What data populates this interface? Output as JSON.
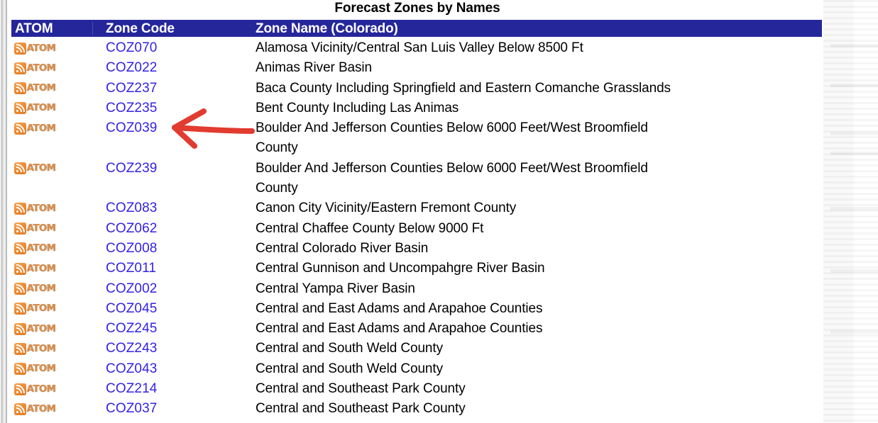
{
  "page": {
    "title": "Forecast Zones by Names"
  },
  "table": {
    "headers": {
      "atom": "ATOM",
      "zone_code": "Zone Code",
      "zone_name": "Zone Name   (Colorado)"
    },
    "atom_label": "ATOM",
    "atom_icon": "rss-feed-icon",
    "rows": [
      {
        "atom": "ATOM",
        "code": "COZ070",
        "name": "Alamosa Vicinity/Central San Luis Valley Below 8500 Ft"
      },
      {
        "atom": "ATOM",
        "code": "COZ022",
        "name": "Animas River Basin"
      },
      {
        "atom": "ATOM",
        "code": "COZ237",
        "name": "Baca County Including Springfield and Eastern Comanche Grasslands"
      },
      {
        "atom": "ATOM",
        "code": "COZ235",
        "name": "Bent County Including Las Animas"
      },
      {
        "atom": "ATOM",
        "code": "COZ039",
        "name": "Boulder And Jefferson Counties Below 6000 Feet/West Broomfield\nCounty"
      },
      {
        "atom": "ATOM",
        "code": "COZ239",
        "name": "Boulder And Jefferson Counties Below 6000 Feet/West Broomfield\nCounty"
      },
      {
        "atom": "ATOM",
        "code": "COZ083",
        "name": "Canon City Vicinity/Eastern Fremont County"
      },
      {
        "atom": "ATOM",
        "code": "COZ062",
        "name": "Central Chaffee County Below 9000 Ft"
      },
      {
        "atom": "ATOM",
        "code": "COZ008",
        "name": "Central Colorado River Basin"
      },
      {
        "atom": "ATOM",
        "code": "COZ011",
        "name": "Central Gunnison and Uncompahgre River Basin"
      },
      {
        "atom": "ATOM",
        "code": "COZ002",
        "name": "Central Yampa River Basin"
      },
      {
        "atom": "ATOM",
        "code": "COZ045",
        "name": "Central and East Adams and Arapahoe Counties"
      },
      {
        "atom": "ATOM",
        "code": "COZ245",
        "name": "Central and East Adams and Arapahoe Counties"
      },
      {
        "atom": "ATOM",
        "code": "COZ243",
        "name": "Central and South Weld County"
      },
      {
        "atom": "ATOM",
        "code": "COZ043",
        "name": "Central and South Weld County"
      },
      {
        "atom": "ATOM",
        "code": "COZ214",
        "name": "Central and Southeast Park County"
      },
      {
        "atom": "ATOM",
        "code": "COZ037",
        "name": "Central and Southeast Park County"
      }
    ]
  },
  "annotation": {
    "type": "hand-drawn-arrow",
    "direction": "left",
    "points_at": "COZ039",
    "color": "#e23b30"
  },
  "colors": {
    "header_bar": "#26269b",
    "link": "#3322e8",
    "text": "#000000",
    "atom_orange": "#ef8b33",
    "annotation_red": "#e23b30",
    "background": "#ffffff"
  }
}
